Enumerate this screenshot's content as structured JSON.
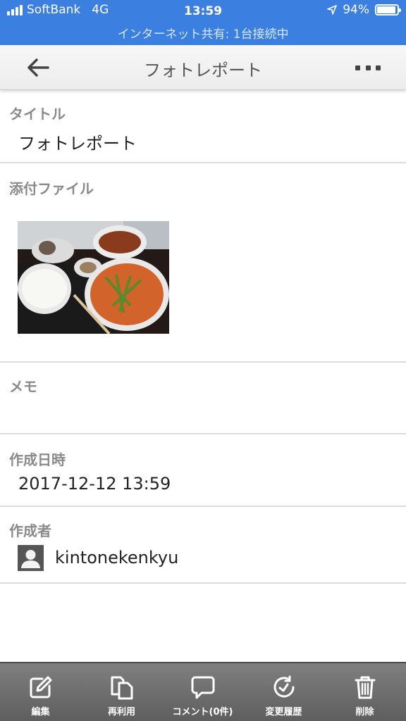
{
  "status_bar": {
    "carrier": "SoftBank",
    "network": "4G",
    "time": "13:59",
    "battery_percent": "94%",
    "battery_level": 0.94,
    "hotspot_text": "インターネット共有: 1台接続中",
    "background_color": "#3b7fe0"
  },
  "nav": {
    "title": "フォトレポート",
    "back_icon": "arrow-left-icon",
    "more_icon": "more-horizontal-icon"
  },
  "record": {
    "title_label": "タイトル",
    "title_value": "フォトレポート",
    "attachment_label": "添付ファイル",
    "attachment_icon": "photo-thumbnail",
    "memo_label": "メモ",
    "memo_value": "",
    "created_at_label": "作成日時",
    "created_at_value": "2017-12-12 13:59",
    "creator_label": "作成者",
    "creator_name": "kintonekenkyu",
    "creator_icon": "user-avatar-icon"
  },
  "toolbar": {
    "background_color": "#6b6b6b",
    "items": [
      {
        "label": "編集",
        "icon": "edit-icon"
      },
      {
        "label": "再利用",
        "icon": "copy-icon"
      },
      {
        "label": "コメント(0件)",
        "icon": "comment-icon"
      },
      {
        "label": "変更履歴",
        "icon": "history-icon"
      },
      {
        "label": "削除",
        "icon": "trash-icon"
      }
    ]
  }
}
